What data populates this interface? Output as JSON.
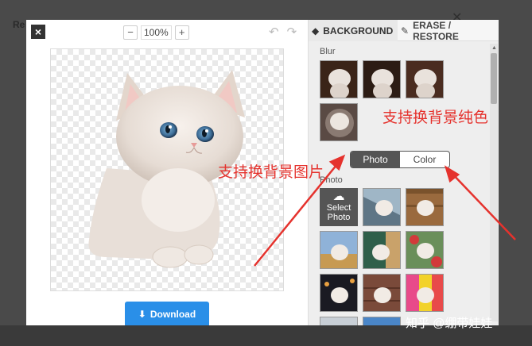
{
  "zoom": {
    "minus": "−",
    "value": "100%",
    "plus": "+"
  },
  "download": {
    "label": "Download"
  },
  "tabs": {
    "background": "BACKGROUND",
    "erase": "ERASE / RESTORE"
  },
  "blur_label": "Blur",
  "toggle": {
    "photo": "Photo",
    "color": "Color"
  },
  "photo_label": "Photo",
  "select_photo": {
    "line1": "Select",
    "line2": "Photo"
  },
  "annotations": {
    "color_text": "支持换背景纯色",
    "photo_text": "支持换背景图片"
  },
  "watermark": "知乎 @绷带娃娃",
  "colors": {
    "accent": "#2a8fe8",
    "annotation": "#e5322d",
    "toggle_active": "#555555"
  },
  "icons": [
    "close-icon",
    "undo-icon",
    "redo-icon",
    "download-icon",
    "layers-icon",
    "eraser-icon",
    "upload-cloud-icon"
  ]
}
